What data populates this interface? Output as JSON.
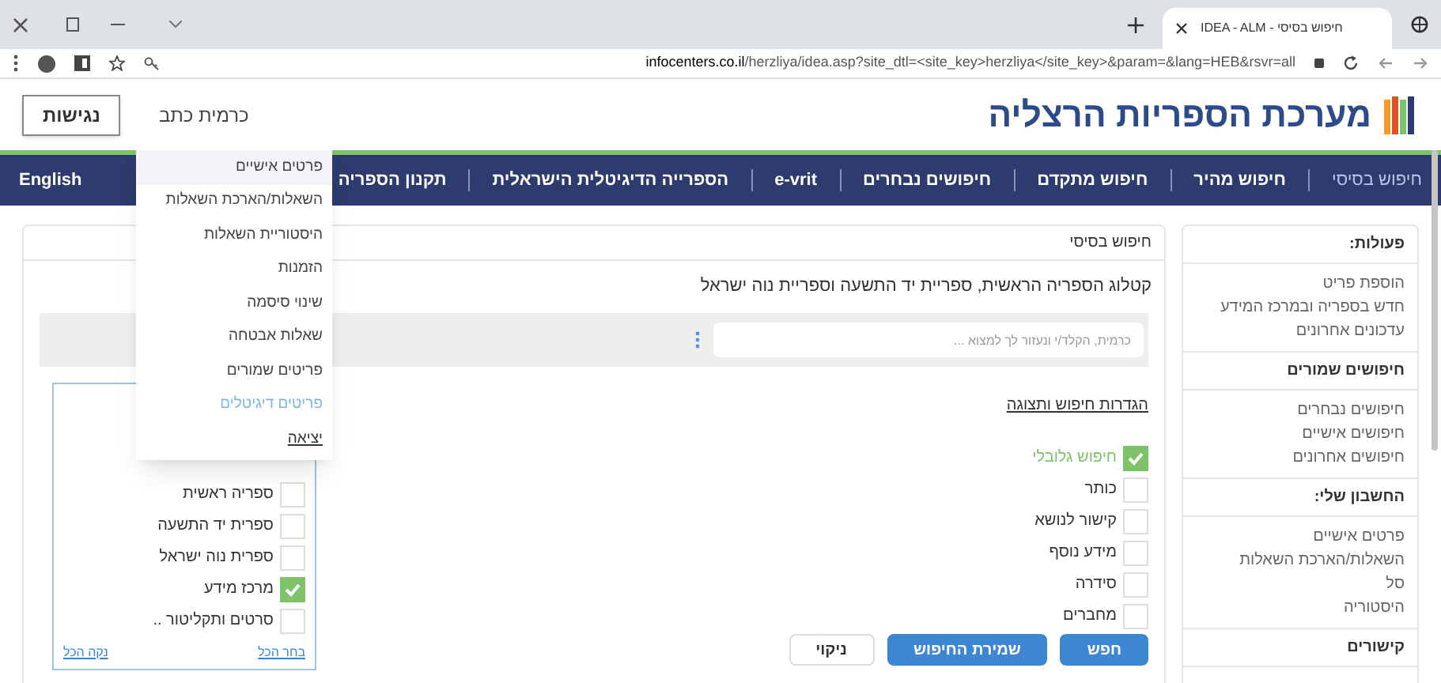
{
  "browser": {
    "tab_title": "IDEA - ALM - חיפוש בסיסי",
    "url_host": "infocenters.co.il",
    "url_path": "/herzliya/idea.asp?site_dtl=<site_key>herzliya</site_key>&param=&lang=HEB&rsvr=all"
  },
  "header": {
    "logo_text": "מערכת הספריות הרצליה",
    "user_name": "כרמית כתב",
    "access_button": "נגישות"
  },
  "nav": [
    {
      "label": "חיפוש בסיסי",
      "selected": true
    },
    {
      "label": "חיפוש מהיר",
      "selected": false
    },
    {
      "label": "חיפוש מתקדם",
      "selected": false
    },
    {
      "label": "חיפושים נבחרים",
      "selected": false
    },
    {
      "label": "e-vrit",
      "selected": false
    },
    {
      "label": "הספרייה הדיגיטלית הישראלית",
      "selected": false
    },
    {
      "label": "תקנון הספריה",
      "selected": false
    },
    {
      "label": "English",
      "selected": false
    }
  ],
  "user_menu": [
    {
      "label": "פרטים אישיים",
      "kind": "item",
      "highlighted": true
    },
    {
      "label": "השאלות/הארכת השאלות",
      "kind": "item",
      "highlighted": false
    },
    {
      "label": "היסטוריית השאלות",
      "kind": "item",
      "highlighted": false
    },
    {
      "label": "הזמנות",
      "kind": "item",
      "highlighted": false
    },
    {
      "label": "שינוי סיסמה",
      "kind": "item",
      "highlighted": false
    },
    {
      "label": "שאלות אבטחה",
      "kind": "item",
      "highlighted": false
    },
    {
      "label": "פריטים שמורים",
      "kind": "item",
      "highlighted": false
    },
    {
      "label": "פריטים דיגיטלים",
      "kind": "link",
      "highlighted": false
    },
    {
      "label": "יציאה",
      "kind": "exit",
      "highlighted": false
    }
  ],
  "sidebar": [
    {
      "title": "פעולות:",
      "links": [
        "הוספת פריט",
        "חדש בספריה ובמרכז המידע",
        "עדכונים אחרונים"
      ]
    },
    {
      "title": "חיפושים שמורים",
      "links": [
        "חיפושים נבחרים",
        "חיפושים אישיים",
        "חיפושים אחרונים"
      ]
    },
    {
      "title": "החשבון שלי:",
      "links": [
        "פרטים אישיים",
        "השאלות/הארכת השאלות",
        "סל",
        "היסטוריה"
      ]
    },
    {
      "title": "קישורים"
    }
  ],
  "main": {
    "title": "חיפוש בסיסי",
    "catalog": "קטלוג הספריה הראשית, ספריית יד התשעה וספריית נוה ישראל",
    "search": {
      "placeholder": "כרמית, הקלד/י ונעזור לך למצוא ..."
    },
    "settings_link": "הגדרות חיפוש ותצוגה",
    "options": [
      {
        "label": "חיפוש גלובלי",
        "checked": true
      },
      {
        "label": "כותר",
        "checked": false
      },
      {
        "label": "קישור לנושא",
        "checked": false
      },
      {
        "label": "מידע נוסף",
        "checked": false
      },
      {
        "label": "סידרה",
        "checked": false
      },
      {
        "label": "מחברים",
        "checked": false
      }
    ],
    "buttons": [
      {
        "label": "חפש",
        "kind": "primary"
      },
      {
        "label": "שמירת החיפוש",
        "kind": "primary"
      },
      {
        "label": "ניקוי",
        "kind": "secondary"
      }
    ],
    "libraries": [
      {
        "label": "ספריה ראשית",
        "checked": false
      },
      {
        "label": "ספרית יד התשעה",
        "checked": false
      },
      {
        "label": "ספרית נוה ישראל",
        "checked": false
      },
      {
        "label": "מרכז מידע",
        "checked": true
      },
      {
        "label": "סרטים ותקליטור ..",
        "checked": false
      }
    ],
    "select_all": "בחר הכל",
    "clear_all": "נקה הכל"
  }
}
